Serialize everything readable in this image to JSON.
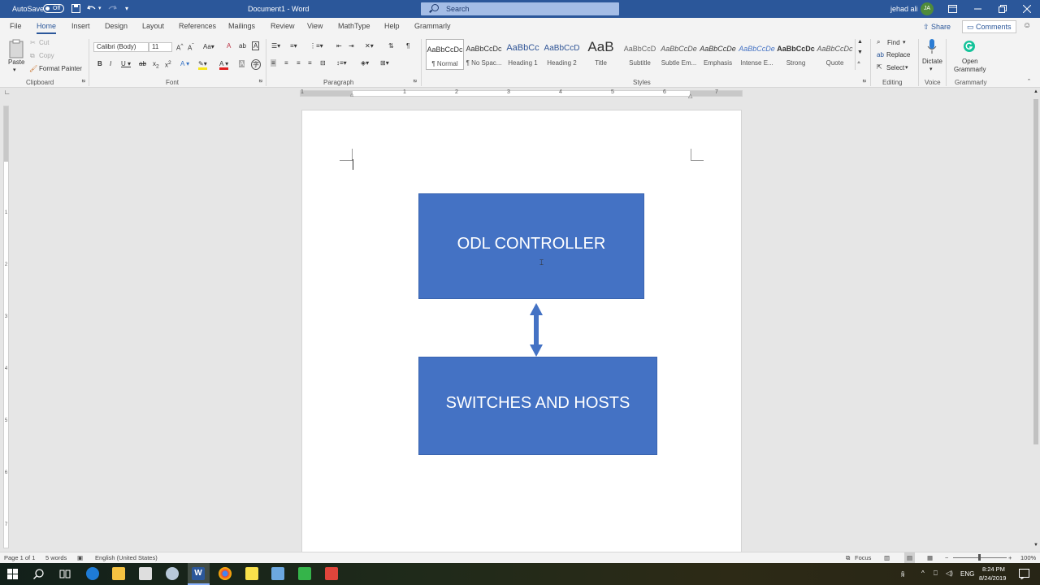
{
  "titlebar": {
    "autosave_label": "AutoSave",
    "autosave_state": "Off",
    "doc_title": "Document1 - Word",
    "search_placeholder": "Search",
    "user_name": "jehad ali",
    "user_initials": "JA"
  },
  "tabs": [
    "File",
    "Home",
    "Insert",
    "Design",
    "Layout",
    "References",
    "Mailings",
    "Review",
    "View",
    "MathType",
    "Help",
    "Grammarly"
  ],
  "active_tab": "Home",
  "share_label": "Share",
  "comments_label": "Comments",
  "clipboard": {
    "paste": "Paste",
    "cut": "Cut",
    "copy": "Copy",
    "format_painter": "Format Painter",
    "label": "Clipboard"
  },
  "font": {
    "name": "Calibri (Body)",
    "size": "11",
    "label": "Font"
  },
  "paragraph": {
    "label": "Paragraph"
  },
  "styles": {
    "label": "Styles",
    "items": [
      {
        "preview": "AaBbCcDc",
        "name": "¶ Normal"
      },
      {
        "preview": "AaBbCcDc",
        "name": "¶ No Spac..."
      },
      {
        "preview": "AaBbCc",
        "name": "Heading 1"
      },
      {
        "preview": "AaBbCcD",
        "name": "Heading 2"
      },
      {
        "preview": "AaB",
        "name": "Title"
      },
      {
        "preview": "AaBbCcD",
        "name": "Subtitle"
      },
      {
        "preview": "AaBbCcDe",
        "name": "Subtle Em..."
      },
      {
        "preview": "AaBbCcDe",
        "name": "Emphasis"
      },
      {
        "preview": "AaBbCcDe",
        "name": "Intense E..."
      },
      {
        "preview": "AaBbCcDc",
        "name": "Strong"
      },
      {
        "preview": "AaBbCcDc",
        "name": "Quote"
      }
    ]
  },
  "editing": {
    "find": "Find",
    "replace": "Replace",
    "select": "Select",
    "label": "Editing"
  },
  "voice": {
    "dictate": "Dictate",
    "label": "Voice"
  },
  "grammarly": {
    "open_line1": "Open",
    "open_line2": "Grammarly",
    "label": "Grammarly"
  },
  "ruler_numbers": [
    "1",
    "1",
    "2",
    "3",
    "4",
    "5",
    "6",
    "7"
  ],
  "vruler_numbers": [
    "1",
    "2",
    "3",
    "4",
    "5",
    "6",
    "7"
  ],
  "diagram": {
    "top_box": "ODL CONTROLLER",
    "bottom_box": "SWITCHES AND HOSTS",
    "fill_color": "#4472c4"
  },
  "status": {
    "page": "Page 1 of 1",
    "words": "5 words",
    "language": "English (United States)",
    "focus": "Focus",
    "zoom": "100%"
  },
  "taskbar": {
    "language": "ENG",
    "time": "8:24 PM",
    "date": "8/24/2019"
  }
}
